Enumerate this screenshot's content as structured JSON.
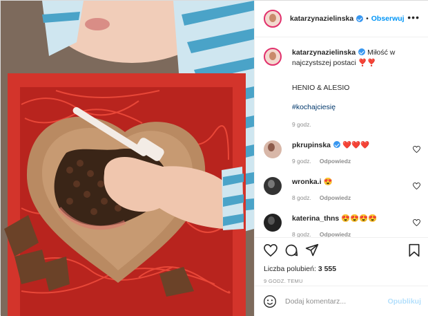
{
  "post": {
    "username": "katarzynazielinska",
    "follow_label": "Obserwuj",
    "more_label": "•••"
  },
  "caption": {
    "username": "katarzynazielinska",
    "text": "Miłość w najczystszej postaci ❣️❣️",
    "line2": "HENIO & ALESIO",
    "hashtag": "#kochajciesię",
    "time": "9 godz."
  },
  "comments": [
    {
      "username": "pkrupinska",
      "verified": true,
      "text": "❤️❤️❤️",
      "time": "9 godz.",
      "reply": "Odpowiedz"
    },
    {
      "username": "wronka.i",
      "verified": false,
      "text": "😍",
      "time": "8 godz.",
      "reply": "Odpowiedz"
    },
    {
      "username": "katerina_thns",
      "verified": false,
      "text": "😍😍😍😍",
      "time": "8 godz.",
      "reply": "Odpowiedz"
    }
  ],
  "likes": {
    "label": "Liczba polubień:",
    "count": "3 555"
  },
  "posted_ago": "9 GODZ. TEMU",
  "composer": {
    "placeholder": "Dodaj komentarz...",
    "publish_label": "Opublikuj"
  },
  "icons": [
    "heart-icon",
    "comment-icon",
    "share-icon",
    "bookmark-icon",
    "emoji-icon",
    "more-icon"
  ],
  "colors": {
    "link": "#0095f6",
    "hashtag": "#00376b",
    "muted": "#8e8e8e",
    "publish_disabled": "#b2dffc"
  }
}
